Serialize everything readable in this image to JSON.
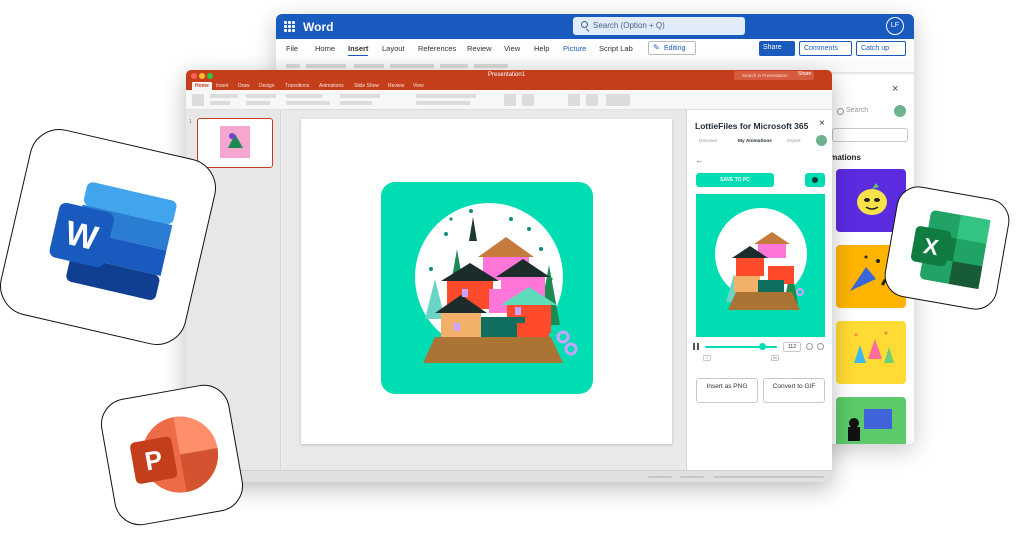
{
  "word": {
    "app_name": "Word",
    "search_placeholder": "Search (Option + Q)",
    "user_initials": "LF",
    "tabs": [
      "File",
      "Home",
      "Insert",
      "Layout",
      "References",
      "Review",
      "View",
      "Help",
      "Picture",
      "Script Lab"
    ],
    "active_tab": "Insert",
    "editing_label": "Editing",
    "share_label": "Share",
    "comments_label": "Comments",
    "catchup_label": "Catch up",
    "pane": {
      "close": "×",
      "search_placeholder": "Search",
      "heading": "imations"
    }
  },
  "powerpoint": {
    "doc_title": "Presentation1",
    "search_placeholder": "Search in Presentation",
    "share_label": "Share",
    "tabs": [
      "Home",
      "Insert",
      "Draw",
      "Design",
      "Transitions",
      "Animations",
      "Slide Show",
      "Review",
      "View"
    ],
    "active_tab": "Home",
    "thumb_number": "1"
  },
  "lottie_pane": {
    "title": "LottieFiles for Microsoft 365",
    "close": "×",
    "tabs": [
      "Discover",
      "My Animations",
      "Import"
    ],
    "active_tab": "My Animations",
    "back_icon": "←",
    "save_button": "SAVE TO PC",
    "frame_value": "112",
    "range_start": "1",
    "range_end": "5s",
    "insert_png_label": "Insert as PNG",
    "convert_gif_label": "Convert to GIF"
  },
  "colors": {
    "word_blue": "#185abd",
    "ppt_red": "#c43e1c",
    "lottie_teal": "#00ddb3",
    "excel_green": "#107c41"
  },
  "icons": [
    "word-app-icon",
    "excel-app-icon",
    "powerpoint-app-icon",
    "search-icon",
    "close-icon",
    "back-arrow-icon",
    "globe-icon",
    "pause-icon"
  ]
}
